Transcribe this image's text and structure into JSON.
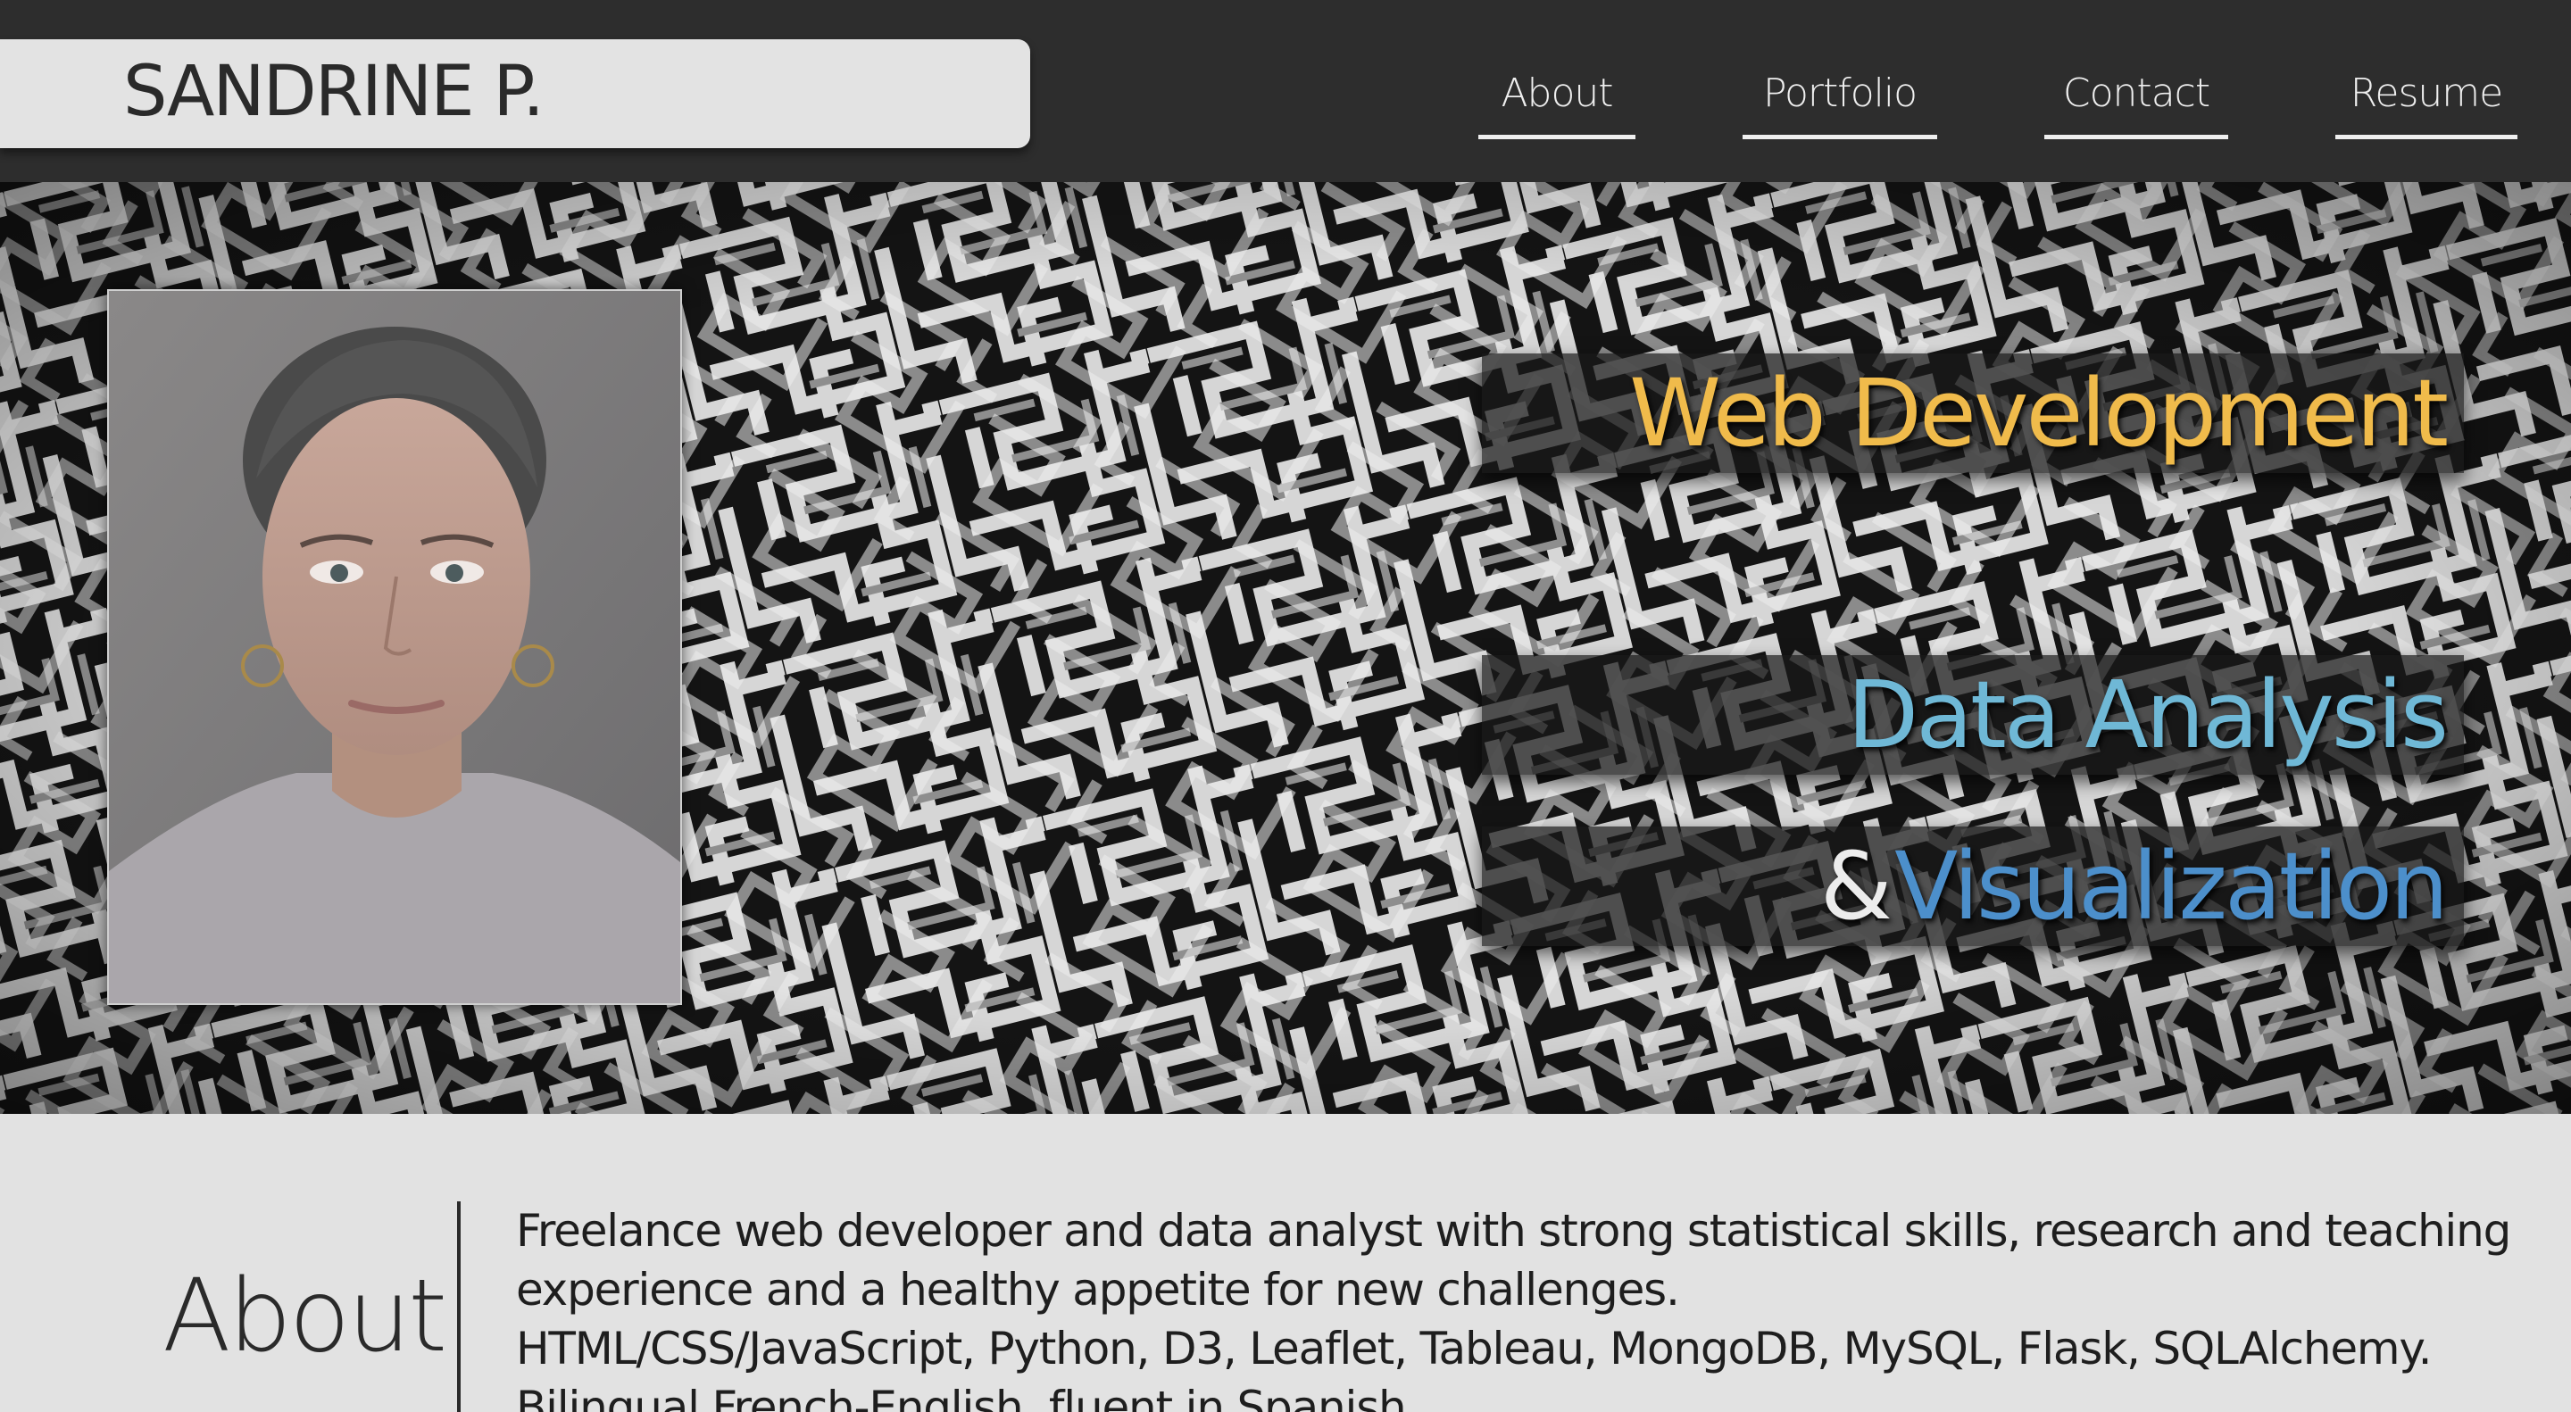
{
  "site": {
    "brand": "SANDRINE P."
  },
  "nav": {
    "items": [
      {
        "label": "About"
      },
      {
        "label": "Portfolio"
      },
      {
        "label": "Contact"
      },
      {
        "label": "Resume"
      }
    ]
  },
  "hero": {
    "taglines": {
      "web": "Web Development",
      "data": "Data Analysis",
      "ampersand": "&",
      "visualization": "Visualization"
    },
    "colors": {
      "web": "#f0bb4b",
      "data": "#6fb8d6",
      "visualization": "#4c8fcb"
    }
  },
  "about": {
    "heading": "About",
    "lines": [
      "Freelance web developer and data analyst with strong statistical skills, research and teaching",
      "experience and a healthy appetite for new challenges.",
      "HTML/CSS/JavaScript, Python, D3, Leaflet, Tableau, MongoDB, MySQL, Flask, SQLAlchemy.",
      "Bilingual French-English, fluent in Spanish."
    ]
  }
}
